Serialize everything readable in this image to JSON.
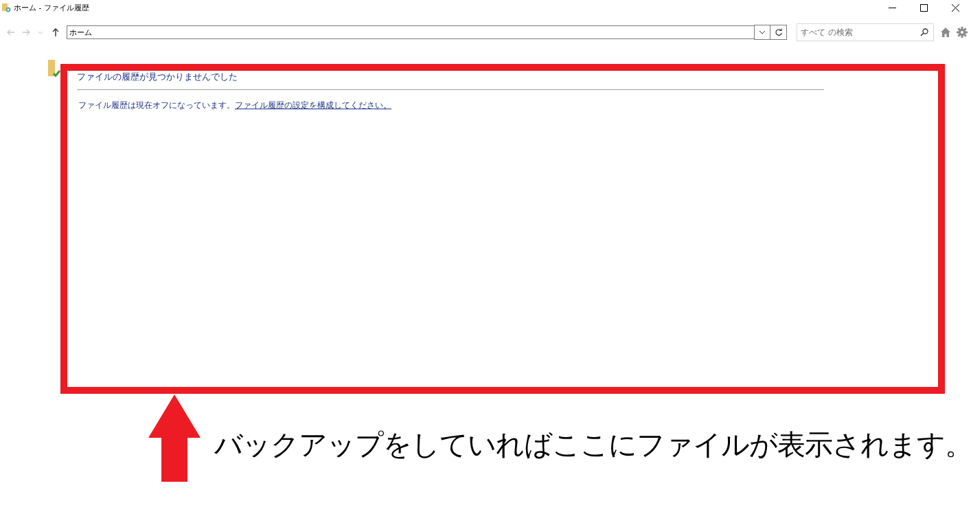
{
  "window": {
    "title": "ホーム - ファイル履歴"
  },
  "nav_buttons": [
    {
      "kind": "back",
      "disabled": true
    },
    {
      "kind": "forward",
      "disabled": true
    },
    {
      "kind": "recent",
      "disabled": true
    },
    {
      "kind": "up",
      "disabled": false
    }
  ],
  "address_bar": {
    "value": "ホーム"
  },
  "search": {
    "placeholder": "すべて の検索"
  },
  "content": {
    "heading": "ファイルの履歴が見つかりませんでした",
    "message": "ファイル履歴は現在オフになっています。",
    "link": "ファイル履歴の設定を構成してください。"
  },
  "annotation": {
    "caption": "バックアップをしていればここにファイルが表示されます。"
  }
}
